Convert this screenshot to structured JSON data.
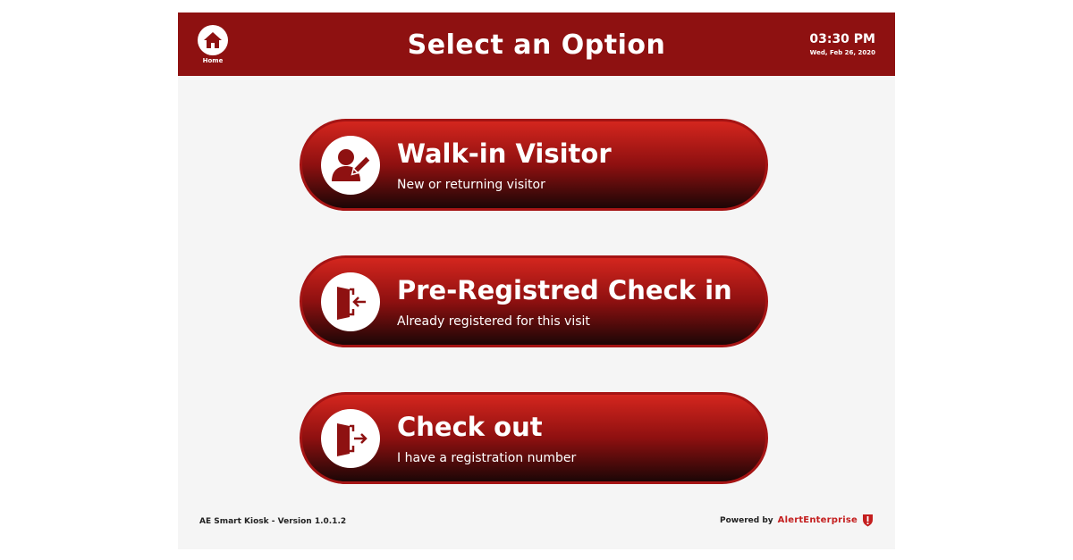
{
  "header": {
    "home_label": "Home",
    "title": "Select an Option",
    "time": "03:30 PM",
    "date": "Wed, Feb 26, 2020"
  },
  "options": [
    {
      "title": "Walk-in Visitor",
      "subtitle": "New or returning visitor",
      "icon": "user-edit-icon"
    },
    {
      "title": "Pre-Registred Check in",
      "subtitle": "Already registered for this visit",
      "icon": "door-enter-icon"
    },
    {
      "title": "Check out",
      "subtitle": "I have a registration number",
      "icon": "door-exit-icon"
    }
  ],
  "footer": {
    "version": "AE Smart Kiosk - Version 1.0.1.2",
    "powered_by": "Powered by",
    "brand": "AlertEnterprise"
  },
  "colors": {
    "header": "#8e1111",
    "button_top": "#d4261e",
    "button_bottom": "#1c0606",
    "background": "#f5f5f5",
    "brand": "#c41e1e"
  }
}
